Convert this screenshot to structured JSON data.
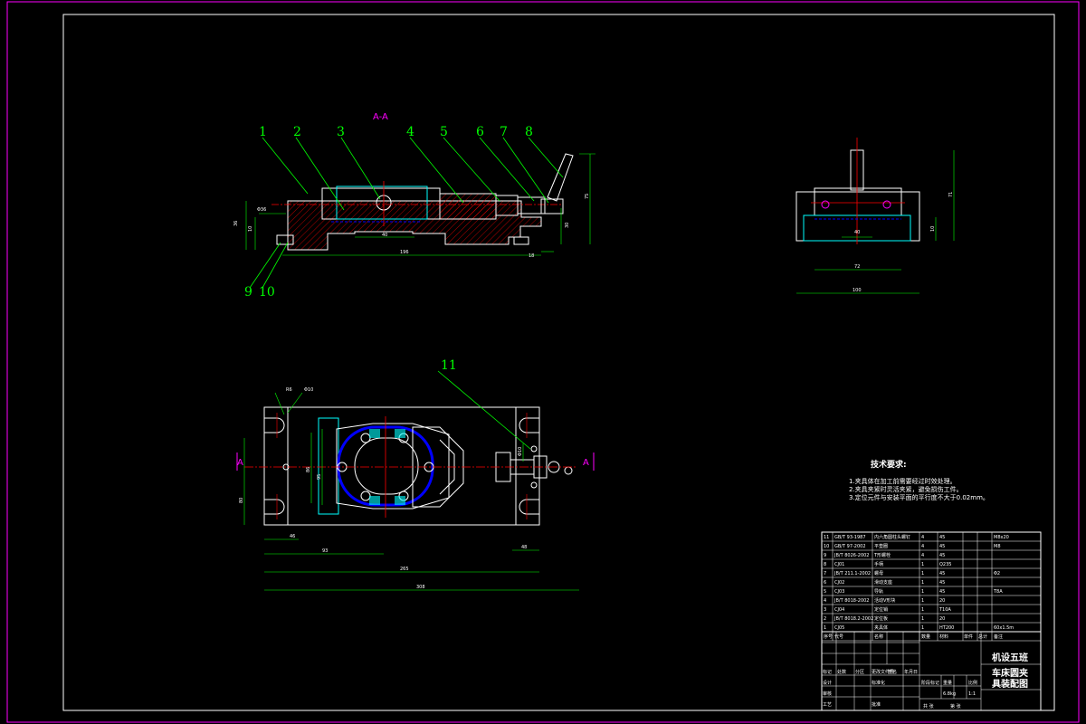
{
  "colors": {
    "background": "#000000",
    "border": "#ff00ff",
    "outline": "#ffffff",
    "balloon": "#00ff00",
    "hatch": "#ff0000",
    "centerline": "#ff0000",
    "hidden": "#0000ff",
    "dimension": "#00ff00"
  },
  "section_view": {
    "title": "A-A",
    "balloons": [
      "1",
      "2",
      "3",
      "4",
      "5",
      "6",
      "7",
      "8",
      "9",
      "10"
    ],
    "dims": {
      "d1": "Φ36",
      "d2": "40",
      "d3": "196",
      "d4": "18",
      "d5": "10",
      "d6": "30",
      "d7": "75",
      "d8": "36"
    }
  },
  "side_view": {
    "dims": {
      "d1": "71",
      "d2": "40",
      "d3": "72",
      "d4": "100",
      "d5": "10"
    }
  },
  "plan_view": {
    "balloon": "11",
    "section_marks": [
      "A",
      "A"
    ],
    "dims": {
      "d1": "R6",
      "d2": "Φ10",
      "d3": "46",
      "d4": "48",
      "d5": "93",
      "d6": "80",
      "d7": "86",
      "d8": "95",
      "d9": "265",
      "d10": "308",
      "d11": "Φ10"
    }
  },
  "tech_requirements": {
    "title": "技术要求:",
    "items": [
      "1.夹具体在加工前需要经过时效处理。",
      "2.夹具夹紧时灵活夹紧，避免损伤工件。",
      "3.定位元件与安装平面的平行度不大于0.02mm。"
    ]
  },
  "parts_list": {
    "rows": [
      {
        "no": "11",
        "code": "GB/T 93-1987",
        "name": "内六角圆柱头螺钉",
        "qty": "4",
        "mat": "45",
        "note": "M8x20"
      },
      {
        "no": "10",
        "code": "GB/T 97-2002",
        "name": "平垫圈",
        "qty": "4",
        "mat": "45",
        "note": "M8"
      },
      {
        "no": "9",
        "code": "JB/T 8026-2002",
        "name": "T形螺栓",
        "qty": "4",
        "mat": "45",
        "note": ""
      },
      {
        "no": "8",
        "code": "CJ01",
        "name": "手柄",
        "qty": "1",
        "mat": "Q235",
        "note": ""
      },
      {
        "no": "7",
        "code": "JB/T 211.1-2002",
        "name": "螺母",
        "qty": "1",
        "mat": "45",
        "note": "Φ2"
      },
      {
        "no": "6",
        "code": "CJ02",
        "name": "滑动支座",
        "qty": "1",
        "mat": "45",
        "note": ""
      },
      {
        "no": "5",
        "code": "CJ03",
        "name": "导轨",
        "qty": "1",
        "mat": "45",
        "note": "T8A"
      },
      {
        "no": "4",
        "code": "JB/T 8018-2002",
        "name": "活动V形块",
        "qty": "1",
        "mat": "20",
        "note": ""
      },
      {
        "no": "3",
        "code": "CJ04",
        "name": "定位销",
        "qty": "1",
        "mat": "T10A",
        "note": ""
      },
      {
        "no": "2",
        "code": "JB/T 8018.2-2002",
        "name": "定位板",
        "qty": "1",
        "mat": "20",
        "note": ""
      },
      {
        "no": "1",
        "code": "CJ05",
        "name": "夹具体",
        "qty": "1",
        "mat": "HT200",
        "note": "60x1.5m"
      }
    ],
    "header": {
      "no": "序号",
      "code": "代号",
      "name": "名称",
      "qty": "数量",
      "mat": "材料",
      "weight1": "单件",
      "weight2": "总计",
      "note": "备注",
      "weight_title": "重量"
    }
  },
  "title_block": {
    "school": "机设五班",
    "drawing_name_1": "车床圆夹",
    "drawing_name_2": "具装配图",
    "labels": [
      "标记",
      "处数",
      "分区",
      "更改文件号",
      "签名",
      "年月日",
      "设计",
      "标准化",
      "阶段标记",
      "重量",
      "比例",
      "审核",
      "工艺",
      "批准",
      "共 张",
      "第 张"
    ],
    "scale": "1:1",
    "weight": "6.8kg"
  }
}
